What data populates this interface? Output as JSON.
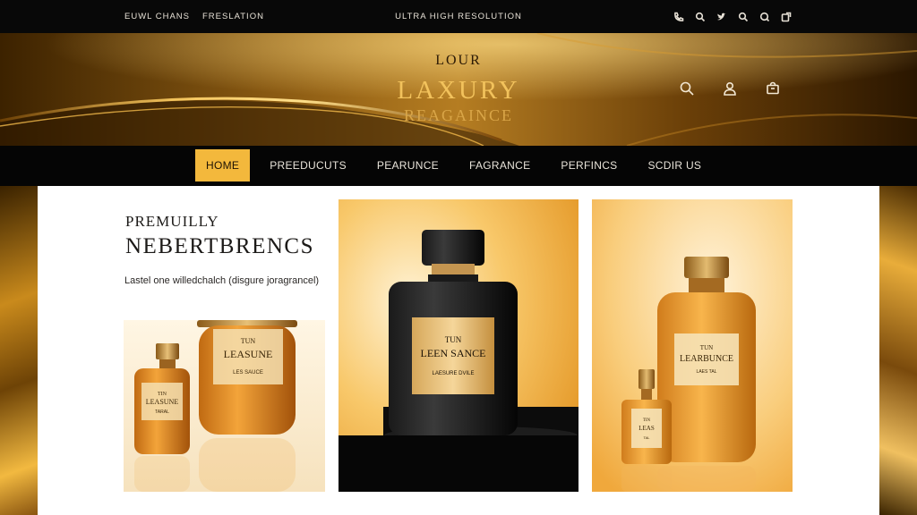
{
  "topbar": {
    "left_links": [
      "EUWL CHANS",
      "FRESLATION"
    ],
    "center_text": "ULTRA HIGH RESOLUTION",
    "icons": [
      "phone-icon",
      "search-icon",
      "twitter-icon",
      "search-icon",
      "chat-icon",
      "external-link-icon"
    ]
  },
  "hero": {
    "subtitle": "LOUR",
    "title": "LAXURY",
    "tagline": "REAGAINCE",
    "icons": [
      "search-icon",
      "account-icon",
      "bag-icon"
    ]
  },
  "nav": {
    "items": [
      "HOME",
      "PREEDUCUTS",
      "PEARUNCE",
      "FAGRANCE",
      "PERFINCS",
      "SCDIR US"
    ],
    "active_index": 0
  },
  "intro": {
    "kicker": "PREMUILLY",
    "title": "NEBERTBRENCS",
    "description": "Lastel one willedchalch (disgure joragrancel)"
  },
  "products": [
    {
      "large_label_top": "TUN",
      "large_label_main": "LEASUNE",
      "large_label_small": "LES SAUCE",
      "small_label_top": "TIN",
      "small_label_main": "LEASUNE",
      "small_label_small": "TARAL"
    },
    {
      "label_top": "TUN",
      "label_main": "LEEN SANCE",
      "label_small": "LAESURE DVILE"
    },
    {
      "large_label_top": "TUN",
      "large_label_main": "LEARBUNCE",
      "large_label_small": "LAES TAL",
      "small_label_top": "TIN",
      "small_label_main": "LEAS",
      "small_label_small": "TAL"
    }
  ],
  "colors": {
    "gold_accent": "#f3b83c",
    "dark_bg": "#050505",
    "hero_title": "#f2c25c"
  }
}
